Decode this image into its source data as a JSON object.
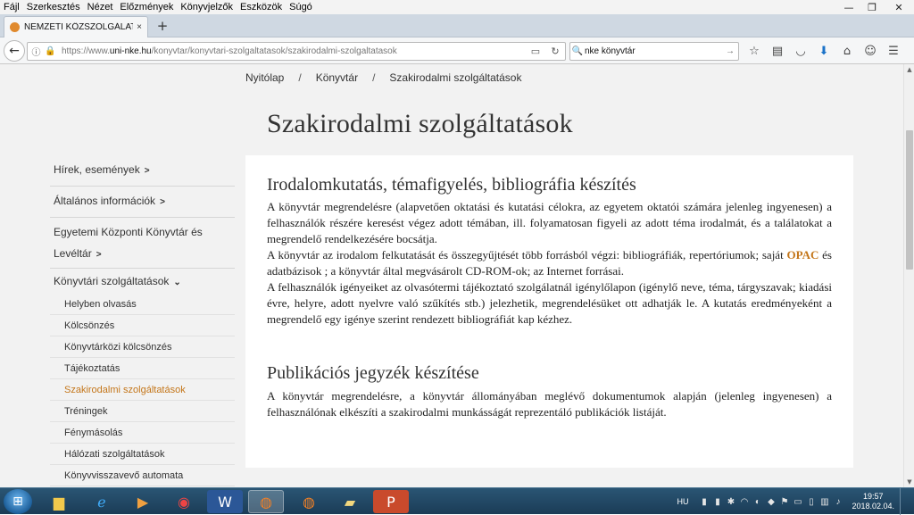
{
  "menubar": {
    "items": [
      "Fájl",
      "Szerkesztés",
      "Nézet",
      "Előzmények",
      "Könyvjelzők",
      "Eszközök",
      "Súgó"
    ]
  },
  "window_controls": {
    "minimize": "—",
    "maximize": "❐",
    "close": "✕"
  },
  "tab": {
    "title": "NEMZETI KÖZSZOLGÁLATI...",
    "close": "×",
    "newtab": "+"
  },
  "navbar": {
    "back": "←",
    "url_prefix": "https://www.",
    "url_domain": "uni-nke.hu",
    "url_path": "/konyvtar/konyvtari-szolgaltatasok/szakirodalmi-szolgaltatasok",
    "search_value": "nke könyvtár"
  },
  "breadcrumb": [
    "Nyitólap",
    "/",
    "Könyvtár",
    "/",
    "Szakirodalmi szolgáltatások"
  ],
  "page_title": "Szakirodalmi szolgáltatások",
  "sidebar": {
    "top": [
      {
        "label": "Hírek, események"
      },
      {
        "label": "Általános információk"
      },
      {
        "label_line1": "Egyetemi Központi Könyvtár és",
        "label_line2": "Levéltár"
      },
      {
        "label": "Könyvtári szolgáltatások"
      }
    ],
    "sub": [
      "Helyben olvasás",
      "Kölcsönzés",
      "Könyvtárközi kölcsönzés",
      "Tájékoztatás",
      "Szakirodalmi szolgáltatások",
      "Tréningek",
      "Fénymásolás",
      "Hálózati szolgáltatások",
      "Könyvvisszavevő automata"
    ],
    "active_index": 4
  },
  "content": {
    "section1": {
      "heading": "Irodalomkutatás, témafigyelés, bibliográfia készítés",
      "p1": "A könyvtár megrendelésre (alapvetően oktatási és kutatási célokra, az egyetem oktatói számára jelenleg ingyenesen) a felhasználók részére keresést végez adott témában, ill. folyamatosan figyeli az adott téma irodalmát, és a találatokat a megrendelő rendelkezésére bocsátja.",
      "p2_before": "A könyvtár az irodalom felkutatását és összegyűjtését több forrásból végzi: bibliográfiák, repertóriumok; saját ",
      "p2_link": "OPAC",
      "p2_after": " és adatbázisok ; a könyvtár által megvásárolt CD-ROM-ok; az Internet forrásai.",
      "p3": "A felhasználók igényeiket az olvasótermi tájékoztató szolgálatnál igénylőlapon (igénylő neve, téma, tárgyszavak; kiadási évre, helyre, adott nyelvre való szűkítés stb.) jelezhetik, megrendelésüket ott adhatják le. A kutatás eredményeként a megrendelő egy igénye szerint rendezett bibliográfiát kap kézhez."
    },
    "section2": {
      "heading": "Publikációs jegyzék készítése",
      "p1": "A könyvtár megrendelésre, a könyvtár állományában meglévő dokumentumok alapján (jelenleg ingyenesen) a felhasználónak elkészíti a szakirodalmi munkásságát reprezentáló publikációk listáját."
    }
  },
  "taskbar": {
    "language": "HU",
    "time": "19:57",
    "date": "2018.02.04."
  },
  "colors": {
    "accent": "#c4761a",
    "page_bg": "#f2f2f2",
    "card_bg": "#ffffff"
  }
}
